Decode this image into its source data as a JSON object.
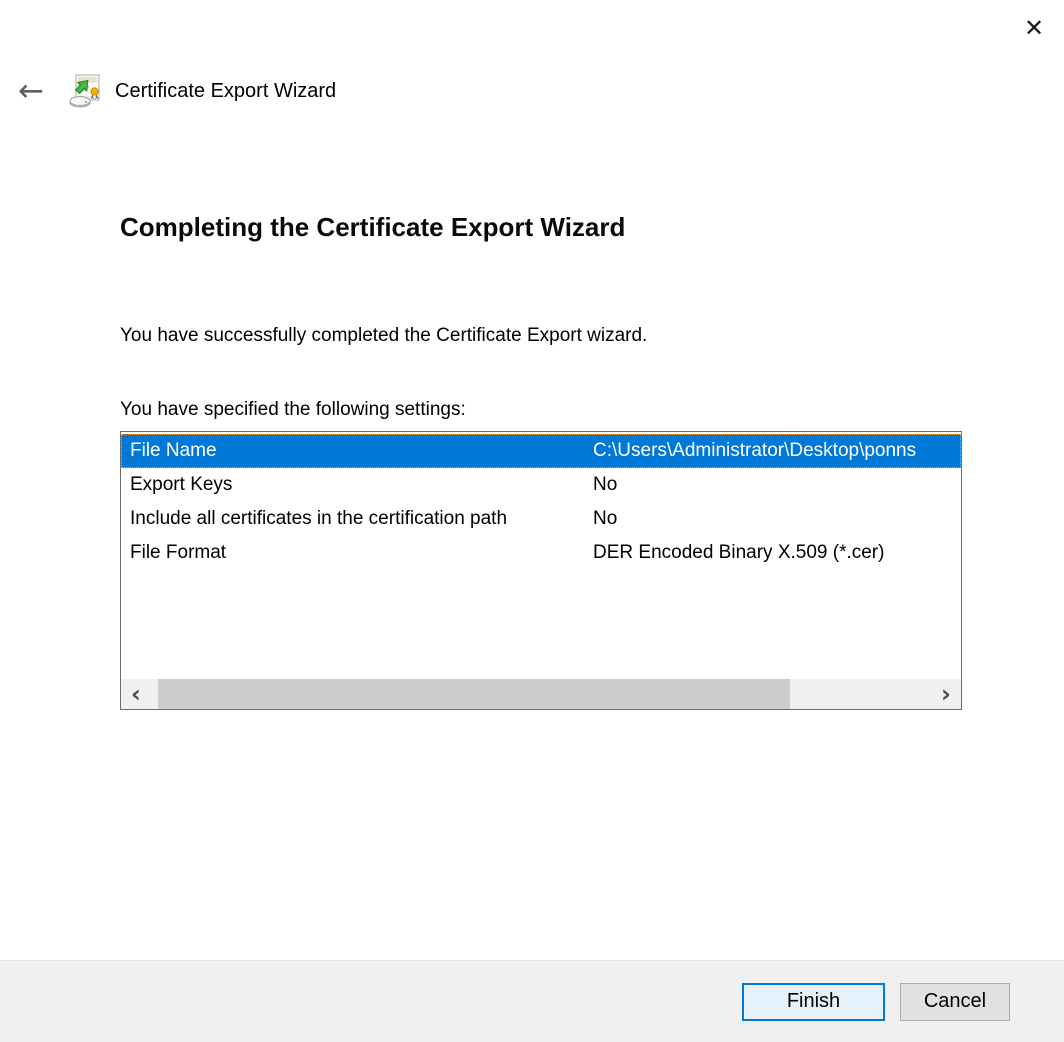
{
  "header": {
    "title": "Certificate Export Wizard"
  },
  "icons": {
    "close": "✕",
    "back": "←",
    "scroll_left": "‹",
    "scroll_right": "›"
  },
  "main": {
    "heading": "Completing the Certificate Export Wizard",
    "success_text": "You have successfully completed the Certificate Export wizard.",
    "settings_label": "You have specified the following settings:",
    "settings": [
      {
        "name": "File Name",
        "value": "C:\\Users\\Administrator\\Desktop\\ponns",
        "selected": true
      },
      {
        "name": "Export Keys",
        "value": "No",
        "selected": false
      },
      {
        "name": "Include all certificates in the certification path",
        "value": "No",
        "selected": false
      },
      {
        "name": "File Format",
        "value": "DER Encoded Binary X.509 (*.cer)",
        "selected": false
      }
    ]
  },
  "footer": {
    "finish_label": "Finish",
    "cancel_label": "Cancel"
  },
  "colors": {
    "selection_bg": "#0078d7",
    "accent": "#0078d7",
    "finish_bg": "#e5f1fb",
    "footer_bg": "#f0f0f0",
    "focus_dots": "#f1a33c",
    "scroll_track": "#f0f0f0",
    "scroll_thumb": "#cdcdcd"
  }
}
